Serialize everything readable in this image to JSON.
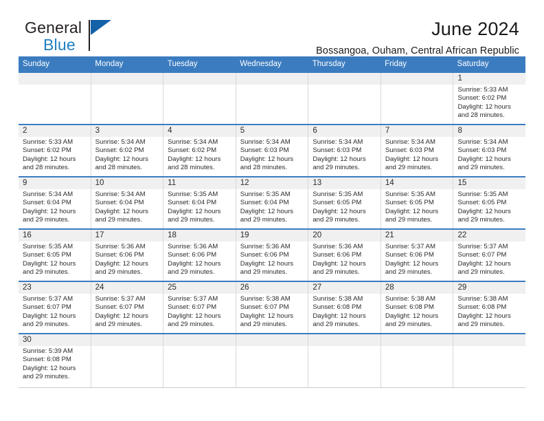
{
  "brand": {
    "name_part1": "General",
    "name_part2": "Blue"
  },
  "header": {
    "title": "June 2024",
    "subtitle": "Bossangoa, Ouham, Central African Republic"
  },
  "colors": {
    "header_blue": "#3b7cc0",
    "brand_blue": "#1f7fc4",
    "date_band": "#f0f0f0",
    "cell_border": "#d7d7d7"
  },
  "weekdays": [
    "Sunday",
    "Monday",
    "Tuesday",
    "Wednesday",
    "Thursday",
    "Friday",
    "Saturday"
  ],
  "weeks": [
    [
      {
        "day": "",
        "lines": [
          "",
          "",
          "",
          ""
        ]
      },
      {
        "day": "",
        "lines": [
          "",
          "",
          "",
          ""
        ]
      },
      {
        "day": "",
        "lines": [
          "",
          "",
          "",
          ""
        ]
      },
      {
        "day": "",
        "lines": [
          "",
          "",
          "",
          ""
        ]
      },
      {
        "day": "",
        "lines": [
          "",
          "",
          "",
          ""
        ]
      },
      {
        "day": "",
        "lines": [
          "",
          "",
          "",
          ""
        ]
      },
      {
        "day": "1",
        "lines": [
          "Sunrise: 5:33 AM",
          "Sunset: 6:02 PM",
          "Daylight: 12 hours",
          "and 28 minutes."
        ]
      }
    ],
    [
      {
        "day": "2",
        "lines": [
          "Sunrise: 5:33 AM",
          "Sunset: 6:02 PM",
          "Daylight: 12 hours",
          "and 28 minutes."
        ]
      },
      {
        "day": "3",
        "lines": [
          "Sunrise: 5:34 AM",
          "Sunset: 6:02 PM",
          "Daylight: 12 hours",
          "and 28 minutes."
        ]
      },
      {
        "day": "4",
        "lines": [
          "Sunrise: 5:34 AM",
          "Sunset: 6:02 PM",
          "Daylight: 12 hours",
          "and 28 minutes."
        ]
      },
      {
        "day": "5",
        "lines": [
          "Sunrise: 5:34 AM",
          "Sunset: 6:03 PM",
          "Daylight: 12 hours",
          "and 28 minutes."
        ]
      },
      {
        "day": "6",
        "lines": [
          "Sunrise: 5:34 AM",
          "Sunset: 6:03 PM",
          "Daylight: 12 hours",
          "and 29 minutes."
        ]
      },
      {
        "day": "7",
        "lines": [
          "Sunrise: 5:34 AM",
          "Sunset: 6:03 PM",
          "Daylight: 12 hours",
          "and 29 minutes."
        ]
      },
      {
        "day": "8",
        "lines": [
          "Sunrise: 5:34 AM",
          "Sunset: 6:03 PM",
          "Daylight: 12 hours",
          "and 29 minutes."
        ]
      }
    ],
    [
      {
        "day": "9",
        "lines": [
          "Sunrise: 5:34 AM",
          "Sunset: 6:04 PM",
          "Daylight: 12 hours",
          "and 29 minutes."
        ]
      },
      {
        "day": "10",
        "lines": [
          "Sunrise: 5:34 AM",
          "Sunset: 6:04 PM",
          "Daylight: 12 hours",
          "and 29 minutes."
        ]
      },
      {
        "day": "11",
        "lines": [
          "Sunrise: 5:35 AM",
          "Sunset: 6:04 PM",
          "Daylight: 12 hours",
          "and 29 minutes."
        ]
      },
      {
        "day": "12",
        "lines": [
          "Sunrise: 5:35 AM",
          "Sunset: 6:04 PM",
          "Daylight: 12 hours",
          "and 29 minutes."
        ]
      },
      {
        "day": "13",
        "lines": [
          "Sunrise: 5:35 AM",
          "Sunset: 6:05 PM",
          "Daylight: 12 hours",
          "and 29 minutes."
        ]
      },
      {
        "day": "14",
        "lines": [
          "Sunrise: 5:35 AM",
          "Sunset: 6:05 PM",
          "Daylight: 12 hours",
          "and 29 minutes."
        ]
      },
      {
        "day": "15",
        "lines": [
          "Sunrise: 5:35 AM",
          "Sunset: 6:05 PM",
          "Daylight: 12 hours",
          "and 29 minutes."
        ]
      }
    ],
    [
      {
        "day": "16",
        "lines": [
          "Sunrise: 5:35 AM",
          "Sunset: 6:05 PM",
          "Daylight: 12 hours",
          "and 29 minutes."
        ]
      },
      {
        "day": "17",
        "lines": [
          "Sunrise: 5:36 AM",
          "Sunset: 6:06 PM",
          "Daylight: 12 hours",
          "and 29 minutes."
        ]
      },
      {
        "day": "18",
        "lines": [
          "Sunrise: 5:36 AM",
          "Sunset: 6:06 PM",
          "Daylight: 12 hours",
          "and 29 minutes."
        ]
      },
      {
        "day": "19",
        "lines": [
          "Sunrise: 5:36 AM",
          "Sunset: 6:06 PM",
          "Daylight: 12 hours",
          "and 29 minutes."
        ]
      },
      {
        "day": "20",
        "lines": [
          "Sunrise: 5:36 AM",
          "Sunset: 6:06 PM",
          "Daylight: 12 hours",
          "and 29 minutes."
        ]
      },
      {
        "day": "21",
        "lines": [
          "Sunrise: 5:37 AM",
          "Sunset: 6:06 PM",
          "Daylight: 12 hours",
          "and 29 minutes."
        ]
      },
      {
        "day": "22",
        "lines": [
          "Sunrise: 5:37 AM",
          "Sunset: 6:07 PM",
          "Daylight: 12 hours",
          "and 29 minutes."
        ]
      }
    ],
    [
      {
        "day": "23",
        "lines": [
          "Sunrise: 5:37 AM",
          "Sunset: 6:07 PM",
          "Daylight: 12 hours",
          "and 29 minutes."
        ]
      },
      {
        "day": "24",
        "lines": [
          "Sunrise: 5:37 AM",
          "Sunset: 6:07 PM",
          "Daylight: 12 hours",
          "and 29 minutes."
        ]
      },
      {
        "day": "25",
        "lines": [
          "Sunrise: 5:37 AM",
          "Sunset: 6:07 PM",
          "Daylight: 12 hours",
          "and 29 minutes."
        ]
      },
      {
        "day": "26",
        "lines": [
          "Sunrise: 5:38 AM",
          "Sunset: 6:07 PM",
          "Daylight: 12 hours",
          "and 29 minutes."
        ]
      },
      {
        "day": "27",
        "lines": [
          "Sunrise: 5:38 AM",
          "Sunset: 6:08 PM",
          "Daylight: 12 hours",
          "and 29 minutes."
        ]
      },
      {
        "day": "28",
        "lines": [
          "Sunrise: 5:38 AM",
          "Sunset: 6:08 PM",
          "Daylight: 12 hours",
          "and 29 minutes."
        ]
      },
      {
        "day": "29",
        "lines": [
          "Sunrise: 5:38 AM",
          "Sunset: 6:08 PM",
          "Daylight: 12 hours",
          "and 29 minutes."
        ]
      }
    ],
    [
      {
        "day": "30",
        "lines": [
          "Sunrise: 5:39 AM",
          "Sunset: 6:08 PM",
          "Daylight: 12 hours",
          "and 29 minutes."
        ]
      },
      {
        "day": "",
        "lines": [
          "",
          "",
          "",
          ""
        ]
      },
      {
        "day": "",
        "lines": [
          "",
          "",
          "",
          ""
        ]
      },
      {
        "day": "",
        "lines": [
          "",
          "",
          "",
          ""
        ]
      },
      {
        "day": "",
        "lines": [
          "",
          "",
          "",
          ""
        ]
      },
      {
        "day": "",
        "lines": [
          "",
          "",
          "",
          ""
        ]
      },
      {
        "day": "",
        "lines": [
          "",
          "",
          "",
          ""
        ]
      }
    ]
  ]
}
